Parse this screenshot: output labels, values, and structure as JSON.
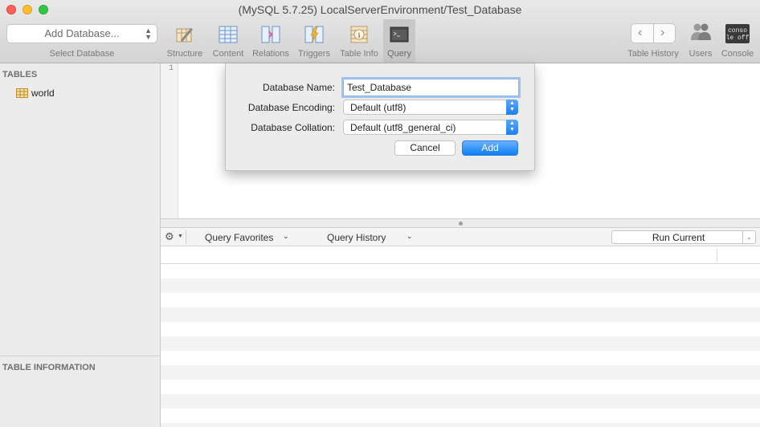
{
  "window": {
    "title": "(MySQL 5.7.25) LocalServerEnvironment/Test_Database"
  },
  "toolbar": {
    "database_select": {
      "value": "Add Database...",
      "label": "Select Database"
    },
    "buttons": [
      {
        "label": "Structure",
        "icon": "structure-icon"
      },
      {
        "label": "Content",
        "icon": "content-icon"
      },
      {
        "label": "Relations",
        "icon": "relations-icon"
      },
      {
        "label": "Triggers",
        "icon": "triggers-icon"
      },
      {
        "label": "Table Info",
        "icon": "table-info-icon"
      },
      {
        "label": "Query",
        "icon": "query-icon",
        "active": true
      }
    ],
    "right_buttons": [
      {
        "label": "Table History",
        "icon": "history-nav-icon"
      },
      {
        "label": "Users",
        "icon": "users-icon"
      },
      {
        "label": "Console",
        "icon": "console-icon",
        "icon_text_top": "conso",
        "icon_text_bottom": "le off"
      }
    ]
  },
  "sidebar": {
    "tables_heading": "TABLES",
    "tables": [
      {
        "name": "world",
        "icon": "table-icon"
      }
    ],
    "info_heading": "TABLE INFORMATION"
  },
  "editor": {
    "line_numbers": [
      "1"
    ]
  },
  "query_bar": {
    "favorites_label": "Query Favorites",
    "history_label": "Query History",
    "run_label": "Run Current"
  },
  "dialog": {
    "name_label": "Database Name:",
    "name_value": "Test_Database",
    "encoding_label": "Database Encoding:",
    "encoding_value": "Default (utf8)",
    "collation_label": "Database Collation:",
    "collation_value": "Default (utf8_general_ci)",
    "cancel_label": "Cancel",
    "add_label": "Add"
  },
  "colors": {
    "accent_blue": "#1c7ef0",
    "active_toolbar_bg": "#c8c8c8",
    "stripe": "#f4f4f4"
  }
}
